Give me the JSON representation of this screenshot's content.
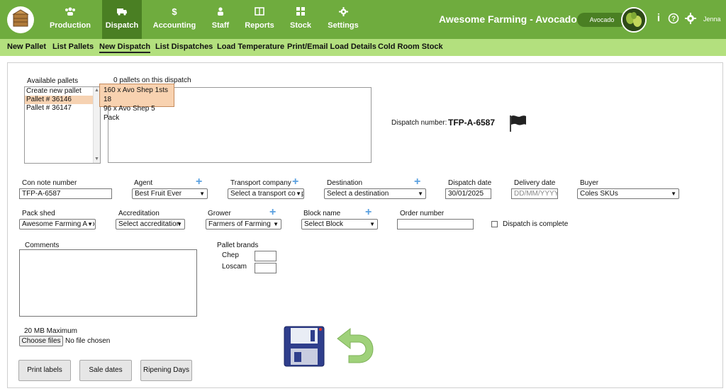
{
  "topnav": {
    "items": [
      {
        "label": "Production",
        "icon": "users-icon"
      },
      {
        "label": "Dispatch",
        "icon": "truck-icon"
      },
      {
        "label": "Accounting",
        "icon": "dollar-icon"
      },
      {
        "label": "Staff",
        "icon": "person-icon"
      },
      {
        "label": "Reports",
        "icon": "book-icon"
      },
      {
        "label": "Stock",
        "icon": "grid-icon"
      },
      {
        "label": "Settings",
        "icon": "gear-icon"
      }
    ],
    "brand": "Awesome Farming - Avocados",
    "crop": "Avocado",
    "user": "Jenna"
  },
  "subnav": {
    "items": [
      "New Pallet",
      "List Pallets",
      "New Dispatch",
      "List Dispatches",
      "Load Temperature",
      "Print/Email Load Details",
      "Cold Room Stock"
    ]
  },
  "pallets": {
    "available_label": "Available pallets",
    "available_items": [
      "Create new pallet",
      "Pallet # 36146",
      "Pallet # 36147"
    ],
    "on_dispatch_label": "0 pallets on this dispatch",
    "tooltip_lines": [
      "160 x Avo Shep 1sts 18",
      "96 x Avo Shep 5 Pack"
    ]
  },
  "dispatch_number": {
    "label": "Dispatch number:",
    "value": "TFP-A-6587"
  },
  "fields": {
    "con_note": {
      "label": "Con note number",
      "value": "TFP-A-6587"
    },
    "agent": {
      "label": "Agent",
      "value": "Best Fruit Ever"
    },
    "transport": {
      "label": "Transport company",
      "value": "Select a transport company"
    },
    "destination": {
      "label": "Destination",
      "value": "Select a destination"
    },
    "dispatch_date": {
      "label": "Dispatch date",
      "value": "30/01/2025"
    },
    "delivery_date": {
      "label": "Delivery date",
      "placeholder": "DD/MM/YYYY"
    },
    "buyer": {
      "label": "Buyer",
      "value": "Coles SKUs"
    },
    "pack_shed": {
      "label": "Pack shed",
      "value": "Awesome Farming Avocados"
    },
    "accreditation": {
      "label": "Accreditation",
      "value": "Select accreditation"
    },
    "grower": {
      "label": "Grower",
      "value": "Farmers of Farming"
    },
    "block": {
      "label": "Block name",
      "value": "Select Block"
    },
    "order": {
      "label": "Order number",
      "value": ""
    },
    "complete": {
      "label": "Dispatch is complete"
    },
    "comments": {
      "label": "Comments"
    },
    "pallet_brands": {
      "label": "Pallet brands",
      "chep": "Chep",
      "loscam": "Loscam"
    }
  },
  "upload": {
    "max": "20 MB Maximum",
    "button": "Choose files",
    "status": "No file chosen"
  },
  "buttons": {
    "print_labels": "Print labels",
    "sale_dates": "Sale dates",
    "ripening_days": "Ripening Days"
  }
}
